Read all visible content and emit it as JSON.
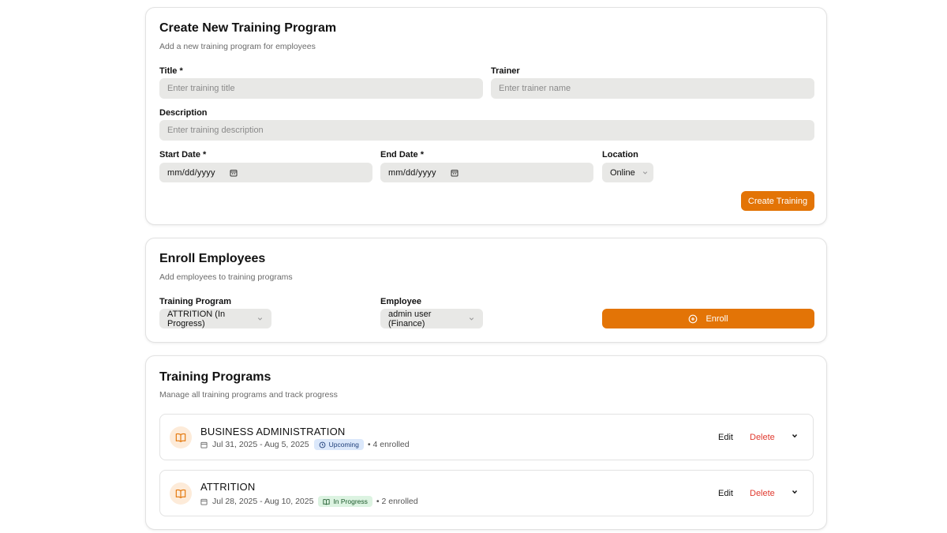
{
  "create_card": {
    "title": "Create New Training Program",
    "subtitle": "Add a new training program for employees",
    "title_label": "Title *",
    "title_placeholder": "Enter training title",
    "trainer_label": "Trainer",
    "trainer_placeholder": "Enter trainer name",
    "description_label": "Description",
    "description_placeholder": "Enter training description",
    "start_date_label": "Start Date *",
    "start_date_value": "mm/dd/yyyy",
    "end_date_label": "End Date *",
    "end_date_value": "mm/dd/yyyy",
    "location_label": "Location",
    "location_value": "Online",
    "submit_label": "Create Training"
  },
  "enroll_card": {
    "title": "Enroll Employees",
    "subtitle": "Add employees to training programs",
    "program_label": "Training Program",
    "program_value": "ATTRITION (In Progress)",
    "employee_label": "Employee",
    "employee_value": "admin user (Finance)",
    "enroll_label": "Enroll"
  },
  "programs_card": {
    "title": "Training Programs",
    "subtitle": "Manage all training programs and track progress",
    "edit_label": "Edit",
    "delete_label": "Delete",
    "items": [
      {
        "name": "BUSINESS ADMINISTRATION",
        "dates": "Jul 31, 2025 - Aug 5, 2025",
        "status": "Upcoming",
        "enrolled": "• 4 enrolled"
      },
      {
        "name": "ATTRITION",
        "dates": "Jul 28, 2025 - Aug 10, 2025",
        "status": "In Progress",
        "enrolled": "• 2 enrolled"
      }
    ]
  },
  "colors": {
    "accent": "#e37406",
    "field_bg": "#e8e8e6",
    "delete": "#e03a2f",
    "badge_upcoming_bg": "#dbe8fb",
    "badge_in_progress_bg": "#dcf3e1"
  }
}
